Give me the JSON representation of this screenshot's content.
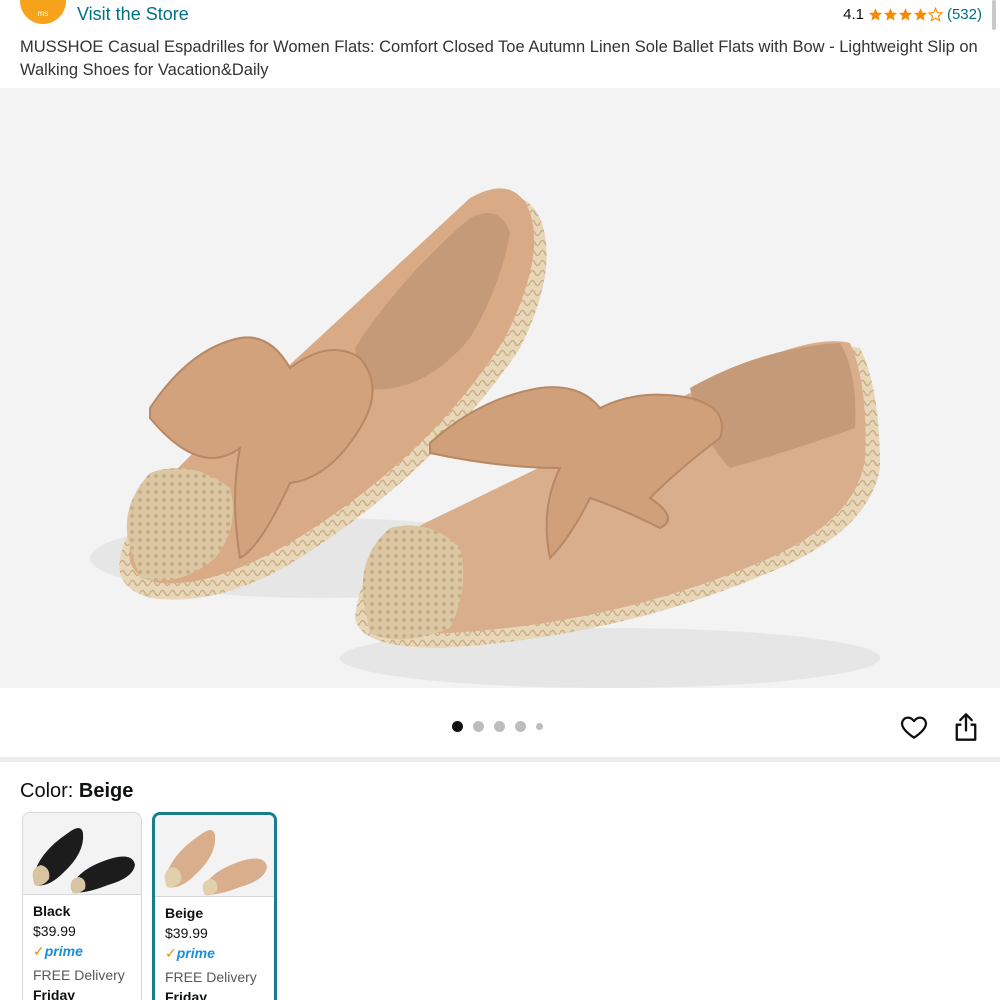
{
  "header": {
    "store_logo_text": "ms",
    "visit_store": "Visit the Store",
    "rating_value": "4.1",
    "rating_stars": 4.1,
    "rating_count": "(532)"
  },
  "product": {
    "title": "MUSSHOE Casual Espadrilles for Women Flats: Comfort Closed Toe Autumn Linen Sole Ballet Flats with Bow - Lightweight Slip on Walking Shoes for Vacation&Daily"
  },
  "gallery": {
    "image_count": 5,
    "active_index": 0,
    "icons": [
      "heart-icon",
      "share-icon"
    ]
  },
  "color": {
    "label": "Color:",
    "selected": "Beige",
    "options": [
      {
        "name": "Black",
        "price": "$39.99",
        "prime_check": "✓",
        "prime": "prime",
        "delivery": "FREE Delivery",
        "day": "Friday"
      },
      {
        "name": "Beige",
        "price": "$39.99",
        "prime_check": "✓",
        "prime": "prime",
        "delivery": "FREE Delivery",
        "day": "Friday"
      }
    ]
  },
  "colors": {
    "link": "#007185",
    "star": "#f58a07",
    "selected_border": "#1c7d8a",
    "prime_blue": "#1a8fd6",
    "shoe_beige": "#d9ae8c"
  }
}
